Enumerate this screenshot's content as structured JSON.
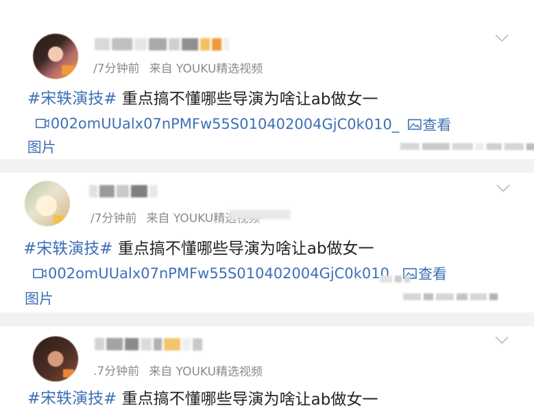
{
  "posts": [
    {
      "meta": {
        "time": "/7分钟前",
        "source": "来自 YOUKU精选视频"
      },
      "content": {
        "hashtag": "#宋轶演技#",
        "text": " 重点搞不懂哪些导演为啥让ab做女一"
      },
      "link": {
        "text": "002omUUalx07nPMFw55S010402004GjC0k010_",
        "view_label": "查看",
        "view_tail": "图片"
      }
    },
    {
      "meta": {
        "time": "/7分钟前",
        "source": "来自 YOUKU精选视频"
      },
      "content": {
        "hashtag": "#宋轶演技#",
        "text": " 重点搞不懂哪些导演为啥让ab做女一"
      },
      "link": {
        "text": "002omUUalx07nPMFw55S010402004GjC0k010",
        "view_label": "查看",
        "view_tail": "图片"
      }
    },
    {
      "meta": {
        "time": ".7分钟前",
        "source": "来自 YOUKU精选视频"
      },
      "content": {
        "hashtag": "#宋轶演技#",
        "text": " 重点搞不懂哪些导演为啥让ab做女一"
      }
    }
  ],
  "colors": {
    "link_blue": "#3d6fb6",
    "meta_gray": "#8a8a8a",
    "text_dark": "#222222",
    "separator": "#f2f2f2"
  },
  "icons": {
    "chevron": "chevron-down-icon",
    "video": "video-link-icon",
    "picture": "picture-icon"
  }
}
